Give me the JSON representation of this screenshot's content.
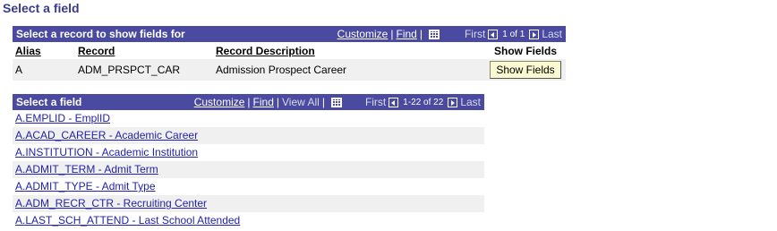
{
  "page_title": "Select a field",
  "record_grid": {
    "title": "Select a record to show fields for",
    "customize": "Customize",
    "find": "Find",
    "first": "First",
    "count": "1 of 1",
    "last": "Last",
    "columns": {
      "alias": "Alias",
      "record": "Record",
      "description": "Record Description",
      "show": "Show Fields"
    },
    "row": {
      "alias": "A",
      "record": "ADM_PRSPCT_CAR",
      "description": "Admission Prospect Career",
      "button": "Show Fields"
    }
  },
  "field_grid": {
    "title": "Select a field",
    "customize": "Customize",
    "find": "Find",
    "view_all": "View All",
    "first": "First",
    "count": "1-22 of 22",
    "last": "Last",
    "fields": [
      "A.EMPLID - EmplID",
      "A.ACAD_CAREER - Academic Career",
      "A.INSTITUTION - Academic Institution",
      "A.ADMIT_TERM - Admit Term",
      "A.ADMIT_TYPE - Admit Type",
      "A.ADM_RECR_CTR - Recruiting Center",
      "A.LAST_SCH_ATTEND - Last School Attended"
    ]
  },
  "colors": {
    "header_bg": "#4a4aa0",
    "title_color": "#3a3a8c",
    "link_color": "#2222aa",
    "button_bg": "#fafad2"
  },
  "icons": [
    "grid-view-icon",
    "arrow-left-icon",
    "arrow-right-icon"
  ]
}
